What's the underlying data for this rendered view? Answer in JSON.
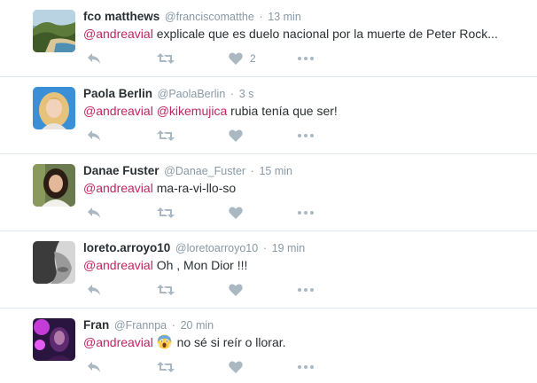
{
  "colors": {
    "accent": "#c0255f",
    "muted": "#8899a6",
    "icon": "#aab8c2",
    "divider": "#e1e8ed"
  },
  "tweets": [
    {
      "fullname": "fco matthews",
      "screenname": "@franciscomatthe",
      "separator": "·",
      "time": "13 min",
      "mentions": [
        "@andreavial"
      ],
      "text": "explicale que es duelo nacional por la muerte de Peter Rock...",
      "like_count": "2",
      "avatar_icon": "landscape-avatar"
    },
    {
      "fullname": "Paola Berlin",
      "screenname": "@PaolaBerlin",
      "separator": "·",
      "time": "3 s",
      "mentions": [
        "@andreavial",
        "@kikemujica"
      ],
      "text": "rubia tenía que ser!",
      "like_count": "",
      "avatar_icon": "blonde-woman-avatar"
    },
    {
      "fullname": "Danae Fuster",
      "screenname": "@Danae_Fuster",
      "separator": "·",
      "time": "15 min",
      "mentions": [
        "@andreavial"
      ],
      "text": "ma-ra-vi-llo-so",
      "like_count": "",
      "avatar_icon": "woman-portrait-avatar"
    },
    {
      "fullname": "loreto.arroyo10",
      "screenname": "@loretoarroyo10",
      "separator": "·",
      "time": "19 min",
      "mentions": [
        "@andreavial"
      ],
      "text": "Oh , Mon Dior !!!",
      "like_count": "",
      "avatar_icon": "grayscale-face-avatar"
    },
    {
      "fullname": "Fran",
      "screenname": "@Frannpa",
      "separator": "·",
      "time": "20 min",
      "mentions": [
        "@andreavial"
      ],
      "emoji": "screaming-face-emoji",
      "text": "no sé si reír o llorar.",
      "like_count": "",
      "avatar_icon": "purple-concert-avatar"
    }
  ],
  "actions": {
    "reply_icon": "reply-icon",
    "retweet_icon": "retweet-icon",
    "like_icon": "heart-icon",
    "more_icon": "more-dots-icon"
  }
}
